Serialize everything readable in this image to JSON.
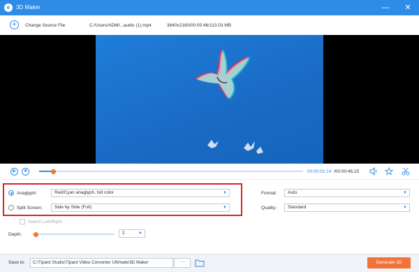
{
  "window": {
    "logo_letter": "e",
    "title": "3D Maker",
    "minimize_glyph": "—",
    "close_glyph": "✕"
  },
  "file": {
    "change_source_label": "Change Source File",
    "path": "C:/Users/ADMI...audio (1).mp4",
    "info": "3840x2160/00:00:46/113.03 MB"
  },
  "player": {
    "current_time": "00:00:02.14",
    "total_time": "/00:00:46.15",
    "progress": 0.055
  },
  "settings": {
    "anaglyph": {
      "label": "Anaglyph:",
      "value": "Red/Cyan anaglyph, full color",
      "selected": true
    },
    "split_screen": {
      "label": "Split Screen:",
      "value": "Side by Side (Full)",
      "selected": false
    },
    "switch_lr": {
      "label": "Switch Left/Right",
      "checked": false
    },
    "depth": {
      "label": "Depth:",
      "value": "2",
      "level": 0.04
    },
    "format": {
      "label": "Format:",
      "value": "Auto"
    },
    "quality": {
      "label": "Quality:",
      "value": "Standard"
    }
  },
  "save": {
    "label": "Save to:",
    "path": "C:\\Tipard Studio\\Tipard Video Converter Ultimate\\3D Maker",
    "browse_label": "···",
    "generate_label": "Generate 3D"
  },
  "colors": {
    "accent": "#2e8be6",
    "generate_button": "#f0743a",
    "highlight_box": "#d9231f"
  }
}
